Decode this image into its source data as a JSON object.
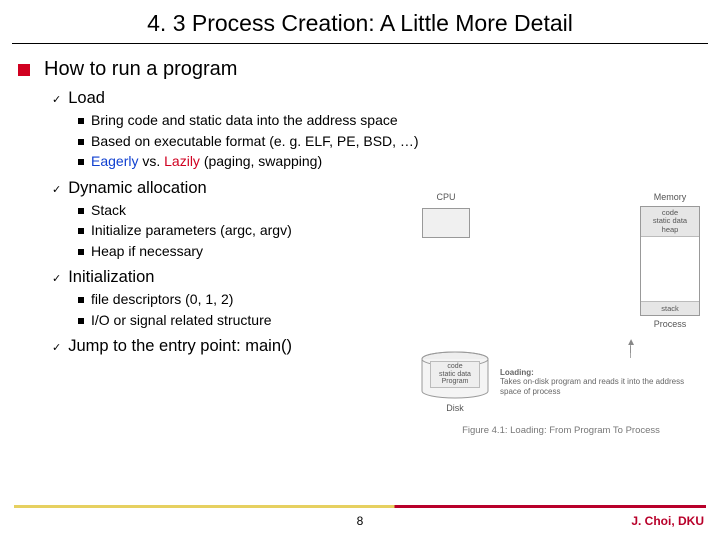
{
  "title": "4. 3 Process Creation: A Little More Detail",
  "heading": "How to run a program",
  "sections": [
    {
      "label": "Load",
      "items": [
        {
          "text": "Bring code and static data into the address space"
        },
        {
          "text": "Based on executable format (e. g. ELF, PE, BSD, …)"
        },
        {
          "pre": "",
          "blue1": "Eagerly",
          "mid": " vs. ",
          "red1": "Lazily",
          "post": " (paging, swapping)"
        }
      ]
    },
    {
      "label": "Dynamic allocation",
      "items": [
        {
          "text": "Stack"
        },
        {
          "text": "Initialize parameters (argc, argv)"
        },
        {
          "text": "Heap if necessary"
        }
      ]
    },
    {
      "label": "Initialization",
      "items": [
        {
          "text": "file descriptors (0, 1, 2)"
        },
        {
          "text": "I/O or signal related structure"
        }
      ]
    },
    {
      "label": "Jump to the entry point: main()",
      "items": []
    }
  ],
  "figure": {
    "cpu": "CPU",
    "memory": "Memory",
    "mem_top": "code\nstatic data\nheap",
    "mem_bot": "stack",
    "process": "Process",
    "disk": "Disk",
    "disk_inner": "code\nstatic data\nProgram",
    "loading_title": "Loading:",
    "loading_text": "Takes on-disk program and reads it into the address space of process",
    "caption": "Figure 4.1: Loading: From Program To Process"
  },
  "page": "8",
  "author": "J. Choi, DKU"
}
